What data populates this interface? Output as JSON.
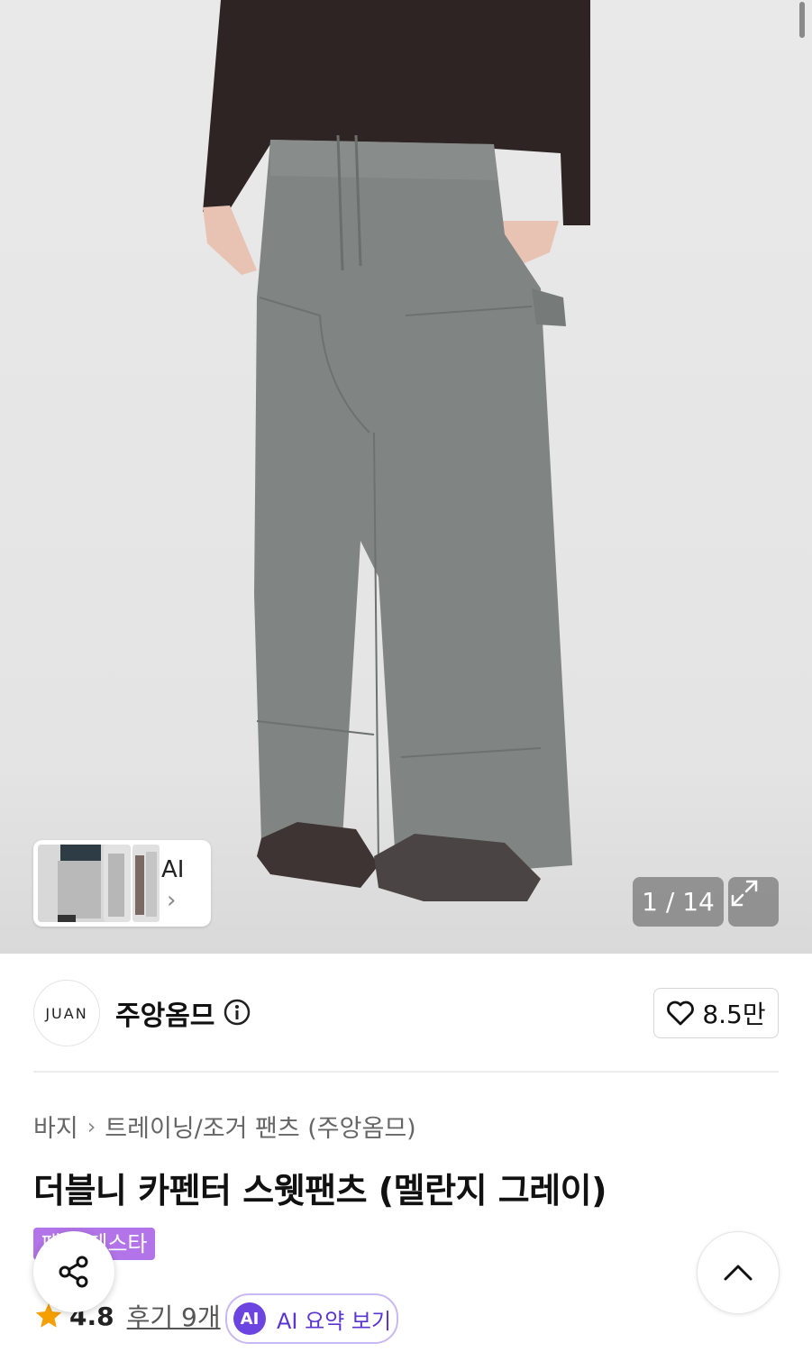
{
  "gallery": {
    "counter": "1 / 14",
    "ai_label": "AI",
    "ai_chevron": "›"
  },
  "brand": {
    "logo_text": "JUAN",
    "name": "주앙옴므",
    "likes": "8.5만"
  },
  "breadcrumb": {
    "category": "바지",
    "subcategory": "트레이닝/조거 팬츠 (주앙옴므)"
  },
  "product": {
    "title": "더블니 카펜터 스웻팬츠 (멜란지 그레이)",
    "badge": "패션 페스타"
  },
  "rating": {
    "score": "4.8",
    "reviews": "후기 9개"
  },
  "ai_summary": {
    "icon_text": "AI",
    "label": "AI 요약 보기"
  },
  "colors": {
    "badge": "#b274e8",
    "ai_accent": "#6c44e0",
    "star": "#f59f00"
  }
}
